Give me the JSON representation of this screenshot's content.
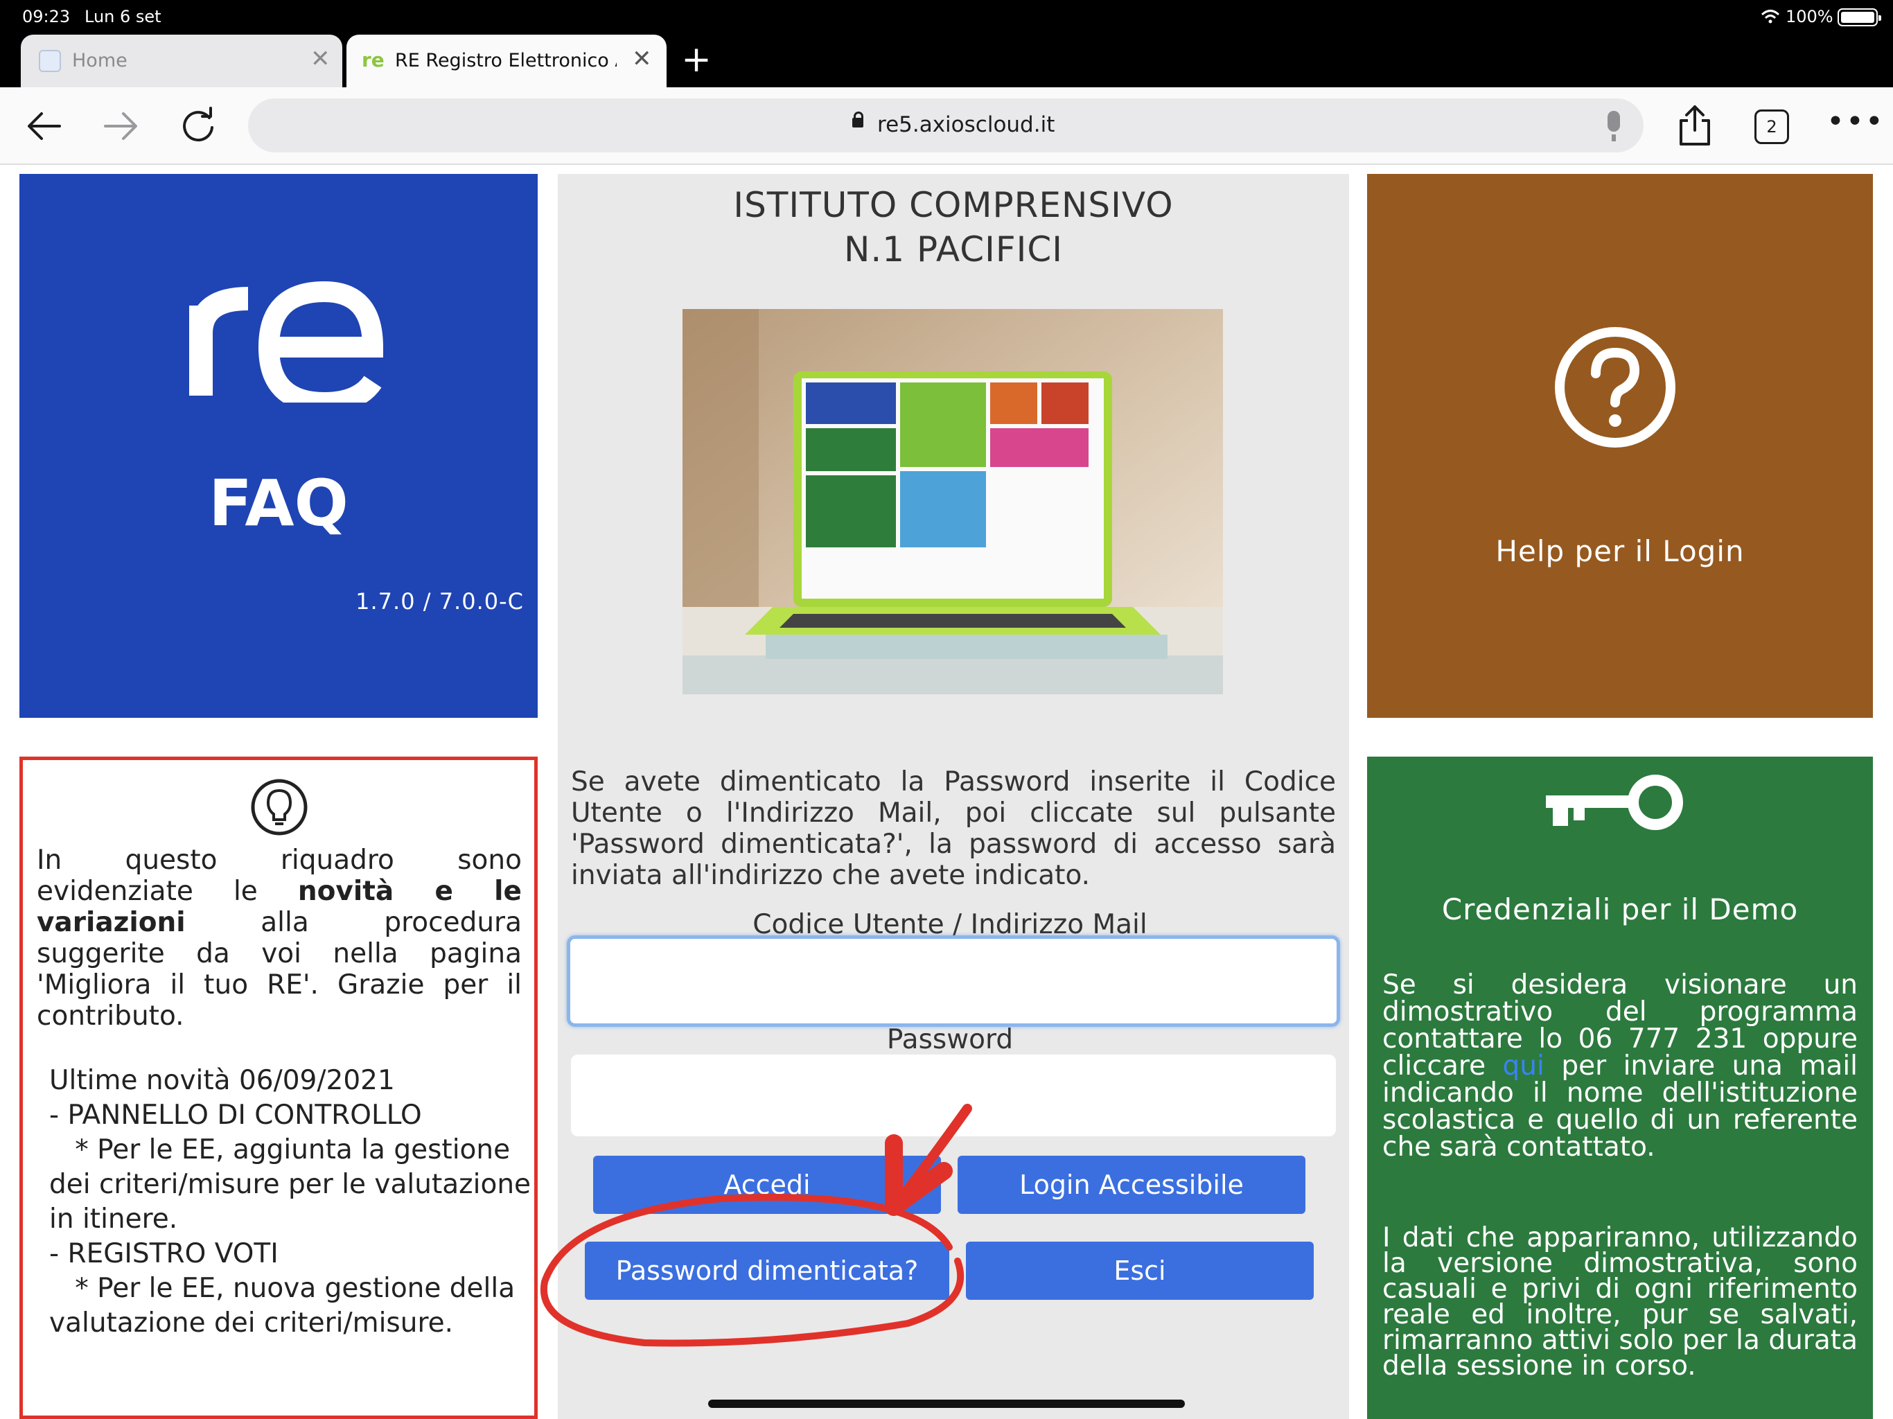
{
  "status_bar": {
    "time": "09:23",
    "date": "Lun 6 set",
    "battery": "100%"
  },
  "tabs": [
    {
      "label": "Home",
      "active": false
    },
    {
      "label": "RE Registro Elettronico A",
      "active": true
    }
  ],
  "toolbar": {
    "url": "re5.axioscloud.it",
    "tab_count": "2"
  },
  "faq_tile": {
    "logo_text": "re",
    "label": "FAQ",
    "version": "1.7.0 / 7.0.0-C"
  },
  "school": {
    "name_line1": "ISTITUTO COMPRENSIVO",
    "name_line2": "N.1 PACIFICI"
  },
  "help_tile": {
    "label": "Help per il Login"
  },
  "news": {
    "intro_before": "In questo riquadro sono evidenziate le ",
    "intro_bold": "novità e le variazioni",
    "intro_after": " alla procedura suggerite da voi nella pagina 'Migliora il tuo RE'. Grazie per il contributo.",
    "updates": "Ultime novità 06/09/2021\n- PANNELLO DI CONTROLLO\n   * Per le EE, aggiunta la gestione dei criteri/misure per le valutazione in itinere.\n- REGISTRO VOTI\n   * Per le EE, nuova gestione della valutazione dei criteri/misure."
  },
  "login_form": {
    "instructions": "Se avete dimenticato la Password inserite il Codice Utente o l'Indirizzo Mail, poi cliccate sul pulsante 'Password dimenticata?', la password di accesso sarà inviata all'indirizzo che avete indicato.",
    "user_label": "Codice Utente / Indirizzo Mail",
    "user_value": "",
    "password_label": "Password",
    "password_value": "",
    "login_button": "Accedi",
    "accessible_login_button": "Login Accessibile",
    "forgot_password_button": "Password dimenticata?",
    "exit_button": "Esci"
  },
  "demo_tile": {
    "title": "Credenziali per il Demo",
    "text_before_link": "Se si desidera visionare un dimostrativo del programma contattare lo 06 777 231 oppure cliccare ",
    "link_text": "qui",
    "text_after_link": " per inviare una mail indicando il nome dell'istituzione scolastica e quello di un referente che sarà contattato.",
    "text_2": "I dati che appariranno, utilizzando la versione dimostrativa, sono casuali e privi di ogni riferimento reale ed inoltre, pur se salvati, rimarranno attivi solo per la durata della sessione in corso."
  },
  "colors": {
    "faq_blue": "#1f44b3",
    "help_brown": "#96591f",
    "demo_green": "#2c7a3e",
    "button_blue": "#3b6fe0",
    "annotation_red": "#e0322a"
  },
  "icons": [
    "wifi-icon",
    "battery-icon",
    "close-icon",
    "plus-icon",
    "back-arrow-icon",
    "forward-arrow-icon",
    "reload-icon",
    "lock-icon",
    "mic-icon",
    "share-icon",
    "more-icon",
    "question-icon",
    "lightbulb-icon",
    "key-icon"
  ]
}
